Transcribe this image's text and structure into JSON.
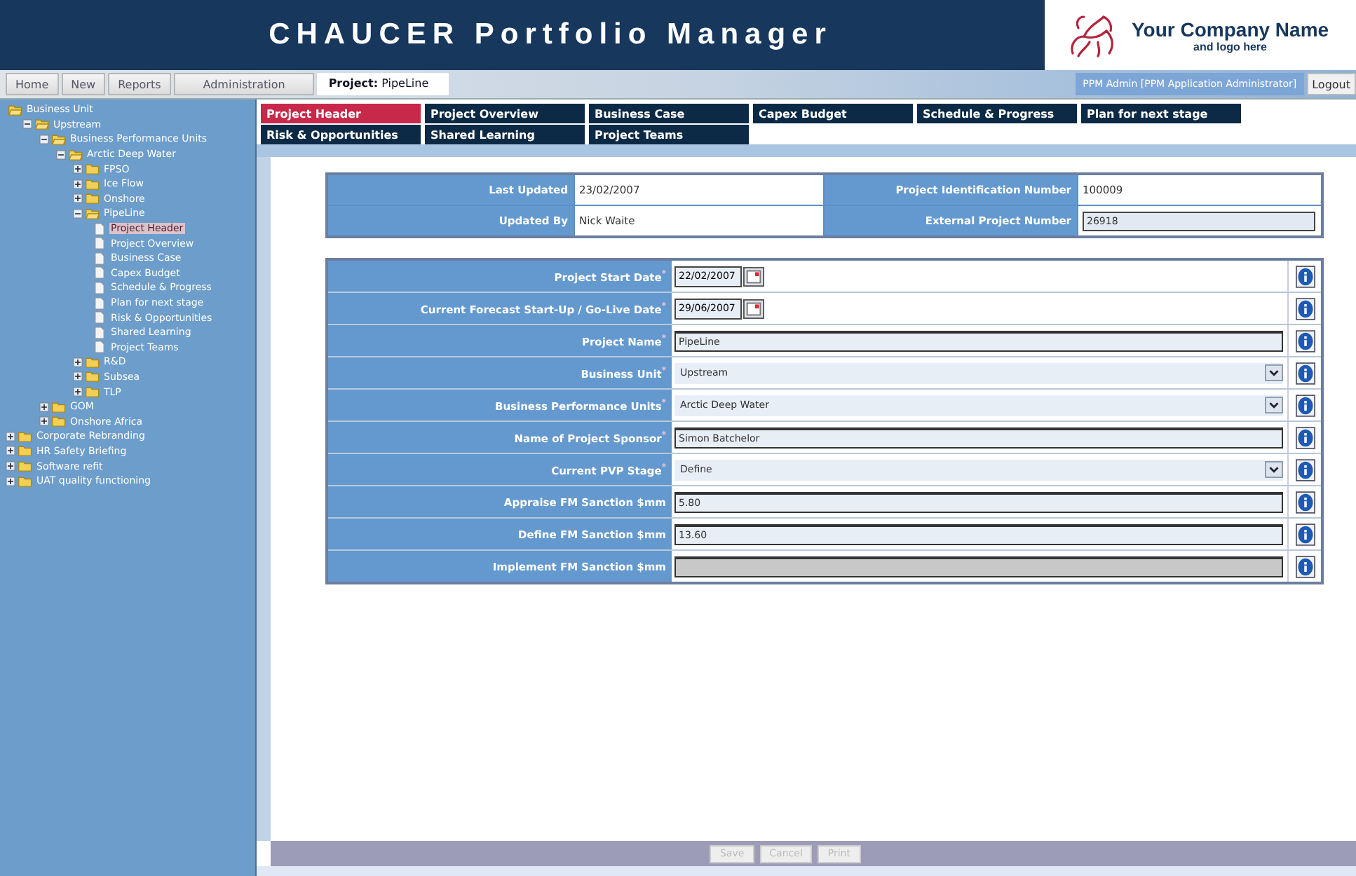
{
  "header": {
    "title": "CHAUCER Portfolio Manager",
    "company_name": "Your Company Name",
    "company_tagline": "and logo here"
  },
  "nav": {
    "buttons": [
      "Home",
      "New",
      "Reports",
      "Administration"
    ],
    "project": "**Project:** PipeLine",
    "user": "PPM Admin [PPM Application Administrator]",
    "logout": "Logout"
  },
  "tree": [
    {
      "label": "Business Unit",
      "kind": "root",
      "expanded": true,
      "children": [
        {
          "label": "Upstream",
          "kind": "folder",
          "expanded": true,
          "children": [
            {
              "label": "Business Performance Units",
              "kind": "folder",
              "expanded": true,
              "children": [
                {
                  "label": "Arctic Deep Water",
                  "kind": "folder",
                  "expanded": true,
                  "children": [
                    {
                      "label": "FPSO",
                      "kind": "folder",
                      "expanded": false
                    },
                    {
                      "label": "Ice Flow",
                      "kind": "folder",
                      "expanded": false
                    },
                    {
                      "label": "Onshore",
                      "kind": "folder",
                      "expanded": false
                    },
                    {
                      "label": "PipeLine",
                      "kind": "folder",
                      "expanded": true,
                      "children": [
                        {
                          "label": "Project Header",
                          "kind": "page",
                          "selected": true
                        },
                        {
                          "label": "Project Overview",
                          "kind": "page",
                          "selected": false
                        },
                        {
                          "label": "Business Case",
                          "kind": "page",
                          "selected": false
                        },
                        {
                          "label": "Capex Budget",
                          "kind": "page",
                          "selected": false
                        },
                        {
                          "label": "Schedule & Progress",
                          "kind": "page",
                          "selected": false
                        },
                        {
                          "label": "Plan for next stage",
                          "kind": "page",
                          "selected": false
                        },
                        {
                          "label": "Risk & Opportunities",
                          "kind": "page",
                          "selected": false
                        },
                        {
                          "label": "Shared Learning",
                          "kind": "page",
                          "selected": false
                        },
                        {
                          "label": "Project Teams",
                          "kind": "page",
                          "selected": false
                        }
                      ]
                    },
                    {
                      "label": "R&D",
                      "kind": "folder",
                      "expanded": false
                    },
                    {
                      "label": "Subsea",
                      "kind": "folder",
                      "expanded": false
                    },
                    {
                      "label": "TLP",
                      "kind": "folder",
                      "expanded": false
                    }
                  ]
                }
              ]
            },
            {
              "label": "GOM",
              "kind": "folder",
              "expanded": false
            },
            {
              "label": "Onshore Africa",
              "kind": "folder",
              "expanded": false
            }
          ]
        }
      ]
    },
    {
      "label": "Corporate Rebranding",
      "kind": "folder",
      "expanded": false
    },
    {
      "label": "HR Safety Briefing",
      "kind": "folder",
      "expanded": false
    },
    {
      "label": "Software refit",
      "kind": "folder",
      "expanded": false
    },
    {
      "label": "UAT quality functioning",
      "kind": "folder",
      "expanded": false
    }
  ],
  "tabs": [
    {
      "label": "Project Header",
      "selected": true
    },
    {
      "label": "Project Overview",
      "selected": false
    },
    {
      "label": "Business Case",
      "selected": false
    },
    {
      "label": "Capex Budget",
      "selected": false
    },
    {
      "label": "Schedule & Progress",
      "selected": false
    },
    {
      "label": "Plan for next stage",
      "selected": false
    },
    {
      "label": "Risk & Opportunities",
      "selected": false
    },
    {
      "label": "Shared Learning",
      "selected": false
    },
    {
      "label": "Project Teams",
      "selected": false
    }
  ],
  "summary": [
    {
      "label": "Last Updated",
      "value": "23/02/2007",
      "kind": "text"
    },
    {
      "label": "Project Identification Number",
      "value": "100009",
      "kind": "text"
    },
    {
      "label": "Updated By",
      "value": "Nick Waite",
      "kind": "text"
    },
    {
      "label": "External Project Number",
      "value": "26918",
      "kind": "field"
    }
  ],
  "form": [
    {
      "label": "Project Start Date$^{*}$",
      "kind": "date",
      "value": "22/02/2007"
    },
    {
      "label": "Current Forecast Start-Up / Go-Live Date$^{*}$",
      "kind": "date",
      "value": "29/06/2007"
    },
    {
      "label": "Project Name$^{*}$",
      "kind": "text",
      "value": "PipeLine"
    },
    {
      "label": "Business Unit$^{*}$",
      "kind": "select",
      "value": "Upstream"
    },
    {
      "label": "Business Performance Units$^{*}$",
      "kind": "select",
      "value": "Arctic Deep Water"
    },
    {
      "label": "Name of Project Sponsor$^{*}$",
      "kind": "text",
      "value": "Simon Batchelor"
    },
    {
      "label": "Current PVP Stage$^{*}$",
      "kind": "select",
      "value": "Define"
    },
    {
      "label": "Appraise FM Sanction $mm",
      "kind": "text",
      "value": "5.80"
    },
    {
      "label": "Define FM Sanction $mm",
      "kind": "text",
      "value": "13.60"
    },
    {
      "label": "Implement FM Sanction $mm",
      "kind": "readonly"
    }
  ],
  "actions": [
    {
      "label": "Save",
      "disabled": true
    },
    {
      "label": "Cancel",
      "disabled": true
    },
    {
      "label": "Print",
      "disabled": true
    }
  ]
}
